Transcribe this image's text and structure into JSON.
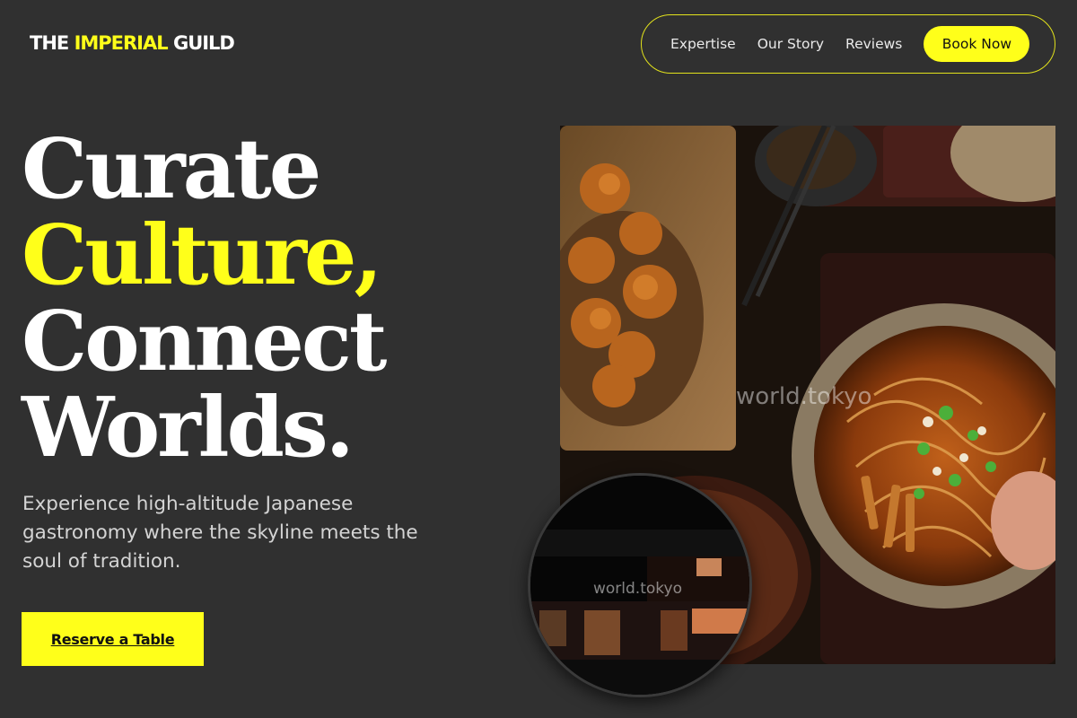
{
  "brand": {
    "part1": "THE ",
    "accent": "IMPERIAL",
    "part2": " GUILD",
    "accent_color": "#ffff1a"
  },
  "nav": {
    "items": [
      {
        "label": "Expertise"
      },
      {
        "label": "Our Story"
      },
      {
        "label": "Reviews"
      }
    ],
    "cta_label": "Book Now"
  },
  "hero": {
    "line1": "Curate",
    "line2": "Culture,",
    "line3": "Connect",
    "line4": "Worlds."
  },
  "subtitle": "Experience high-altitude Japanese gastronomy where the skyline meets the soul of tradition.",
  "cta": {
    "label": "Reserve a Table"
  },
  "images": {
    "main_watermark": "world.tokyo",
    "circle_watermark": "world.tokyo"
  }
}
